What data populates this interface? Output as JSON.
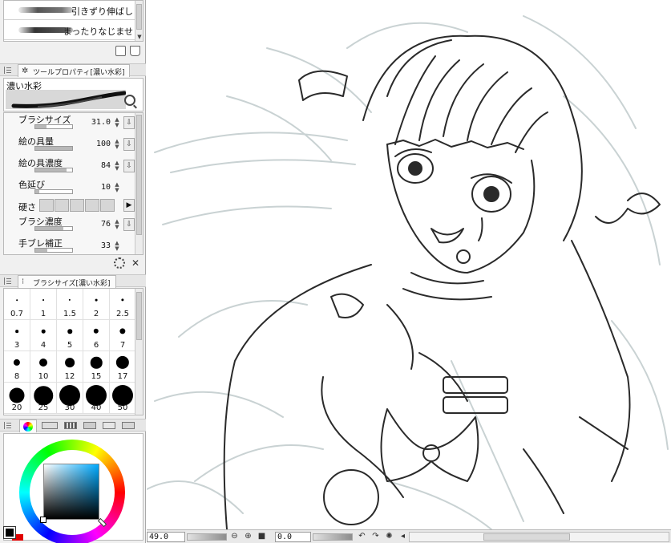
{
  "brush_list": {
    "items": [
      {
        "label": "引きずり伸ばし"
      },
      {
        "label": "まったりなじませ"
      }
    ]
  },
  "tool_property": {
    "tab_label": "ツールプロパティ[濃い水彩]",
    "brush_name": "濃い水彩",
    "params": [
      {
        "label": "ブラシサイズ",
        "value": "31.0",
        "level": 0.31
      },
      {
        "label": "絵の具量",
        "value": "100",
        "level": 1.0
      },
      {
        "label": "絵の具濃度",
        "value": "84",
        "level": 0.84
      },
      {
        "label": "色延び",
        "value": "10",
        "level": 0.1
      },
      {
        "label": "ブラシ濃度",
        "value": "76",
        "level": 0.76
      },
      {
        "label": "手ブレ補正",
        "value": "33",
        "level": 0.33
      }
    ],
    "hardness_label": "硬さ"
  },
  "brush_size": {
    "tab_label": "ブラシサイズ[濃い水彩]",
    "sizes": [
      "0.7",
      "1",
      "1.5",
      "2",
      "2.5",
      "3",
      "4",
      "5",
      "6",
      "7",
      "8",
      "10",
      "12",
      "15",
      "17",
      "20",
      "25",
      "30",
      "40",
      "50"
    ]
  },
  "status": {
    "zoom": "49.0",
    "rotation": "0.0"
  },
  "colors": {
    "foreground": "#000000",
    "background": "#e00000",
    "accent": "#00aaff"
  }
}
